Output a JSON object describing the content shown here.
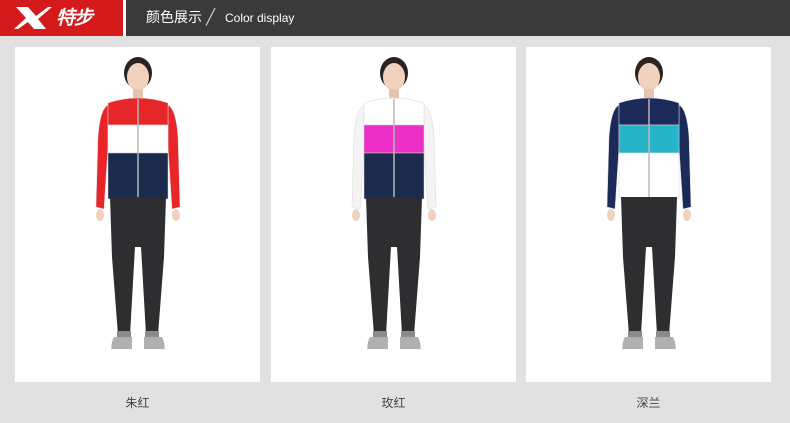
{
  "header": {
    "logo_text": "特步",
    "title_cn": "颜色展示",
    "separator": "╱",
    "title_en": "Color display"
  },
  "colors": {
    "brand_red": "#d41a1a",
    "header_bg": "#3a3a3a",
    "page_bg": "#e1e1e1"
  },
  "products": [
    {
      "caption": "朱红",
      "top": "#e8262a",
      "mid": "#ffffff",
      "bottom": "#1c2a4d",
      "sleeve": "#e8262a"
    },
    {
      "caption": "玫红",
      "top": "#ffffff",
      "mid": "#ec2fc6",
      "bottom": "#1c2a4d",
      "sleeve": "#f4f4f4"
    },
    {
      "caption": "深兰",
      "top": "#1c2a5a",
      "mid": "#25b4c8",
      "bottom": "#ffffff",
      "sleeve": "#1c2a5a"
    }
  ]
}
